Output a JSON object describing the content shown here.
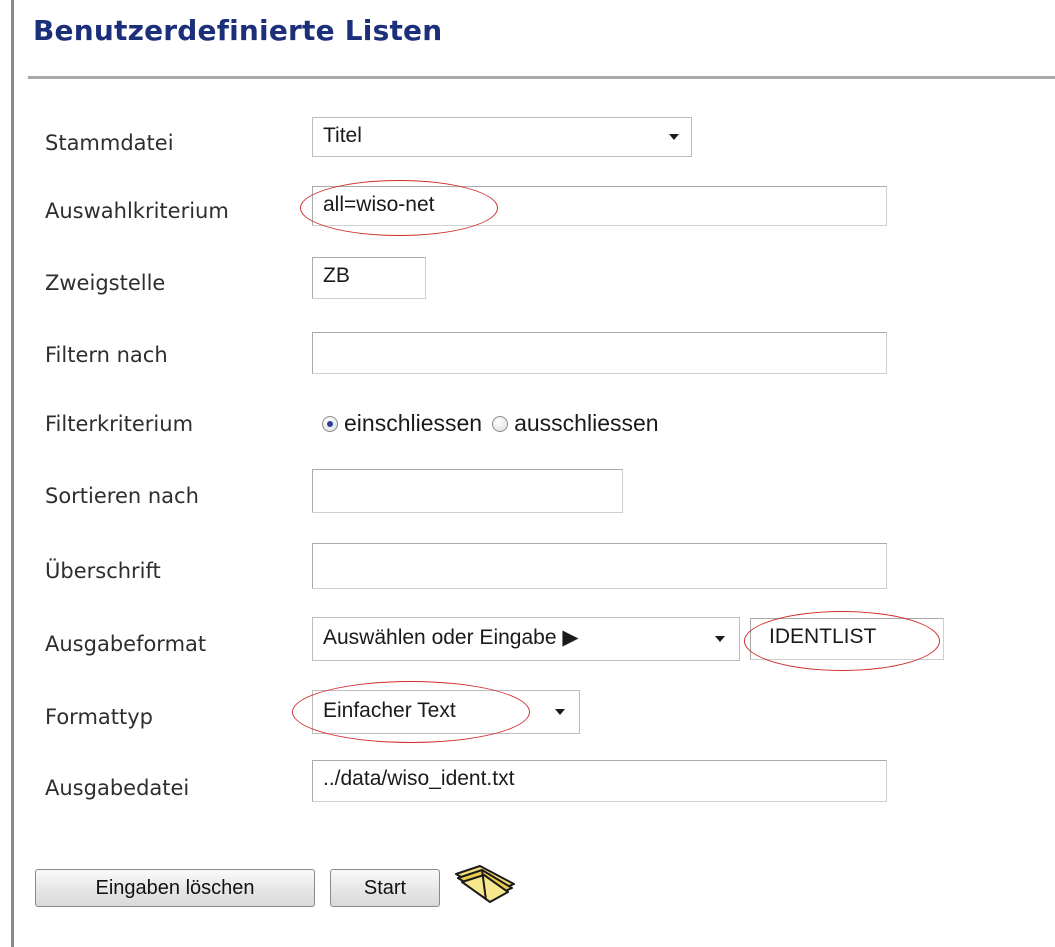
{
  "page": {
    "title": "Benutzerdefinierte Listen"
  },
  "form": {
    "stammdatei": {
      "label": "Stammdatei",
      "value": "Titel"
    },
    "auswahlkriterium": {
      "label": "Auswahlkriterium",
      "value": "all=wiso-net"
    },
    "zweigstelle": {
      "label": "Zweigstelle",
      "value": "ZB"
    },
    "filtern_nach": {
      "label": "Filtern nach",
      "value": ""
    },
    "filterkriterium": {
      "label": "Filterkriterium",
      "options": [
        "einschliessen",
        "ausschliessen"
      ],
      "selected": "einschliessen"
    },
    "sortieren_nach": {
      "label": "Sortieren nach",
      "value": ""
    },
    "ueberschrift": {
      "label": "Überschrift",
      "value": ""
    },
    "ausgabeformat": {
      "label": "Ausgabeformat",
      "select_value": "Auswählen oder Eingabe ▶",
      "input_value": "IDENTLIST"
    },
    "formattyp": {
      "label": "Formattyp",
      "value": "Einfacher Text"
    },
    "ausgabedatei": {
      "label": "Ausgabedatei",
      "value": "../data/wiso_ident.txt"
    }
  },
  "buttons": {
    "clear_label": "Eingaben löschen",
    "start_label": "Start"
  },
  "icons": {
    "help": "book-icon"
  },
  "colors": {
    "title": "#1c2f7a",
    "annotation": "#d02c2c"
  }
}
